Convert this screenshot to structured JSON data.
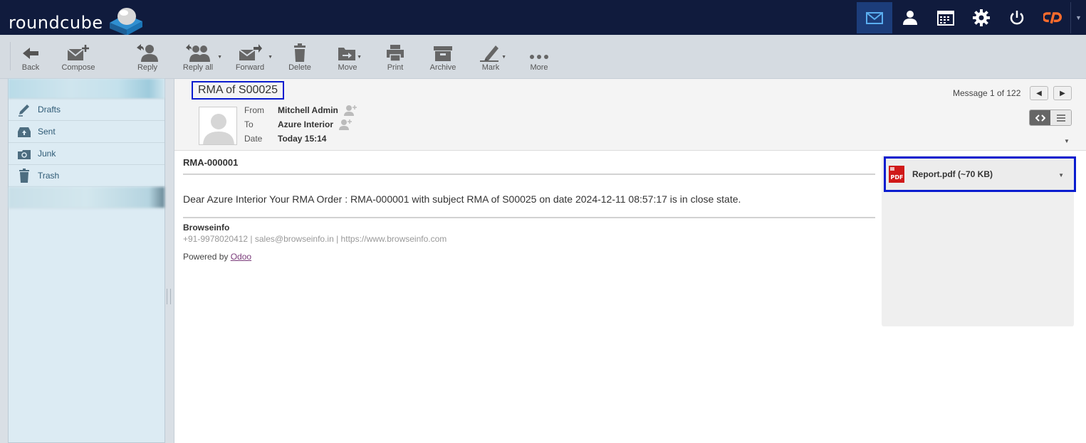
{
  "app": {
    "logo_text": "roundcube"
  },
  "topnav": [
    {
      "name": "mail",
      "icon": "envelope-icon",
      "active": true
    },
    {
      "name": "contacts",
      "icon": "person-icon"
    },
    {
      "name": "calendar",
      "icon": "calendar-icon"
    },
    {
      "name": "settings",
      "icon": "gear-icon"
    },
    {
      "name": "logout",
      "icon": "power-icon"
    },
    {
      "name": "cpanel",
      "icon": "cpanel-logo-icon"
    }
  ],
  "toolbar": {
    "back": "Back",
    "compose": "Compose",
    "reply": "Reply",
    "reply_all": "Reply all",
    "forward": "Forward",
    "delete": "Delete",
    "move": "Move",
    "print": "Print",
    "archive": "Archive",
    "mark": "Mark",
    "more": "More"
  },
  "sidebar": {
    "folders": [
      {
        "label": "Drafts",
        "icon": "pencil-icon"
      },
      {
        "label": "Sent",
        "icon": "sent-tray-icon"
      },
      {
        "label": "Junk",
        "icon": "junk-icon"
      },
      {
        "label": "Trash",
        "icon": "trash-icon"
      }
    ]
  },
  "message": {
    "subject": "RMA of S00025",
    "from_label": "From",
    "from": "Mitchell Admin",
    "to_label": "To",
    "to": "Azure Interior",
    "date_label": "Date",
    "date": "Today 15:14",
    "count": "Message 1 of 122",
    "rma_id": "RMA-000001",
    "body": "Dear Azure Interior Your RMA Order : RMA-000001 with subject RMA of S00025 on date 2024-12-11 08:57:17 is in close state.",
    "signature_name": "Browseinfo",
    "signature_contact": "+91-9978020412 | sales@browseinfo.in | https://www.browseinfo.com",
    "powered_prefix": "Powered by ",
    "powered_link": "Odoo"
  },
  "attachment": {
    "label": "Report.pdf (~70 KB)",
    "icon": "pdf-icon"
  },
  "colors": {
    "topbar": "#101b3d",
    "highlight_border": "#0a1ccf",
    "sidebar": "#dcebf3"
  }
}
